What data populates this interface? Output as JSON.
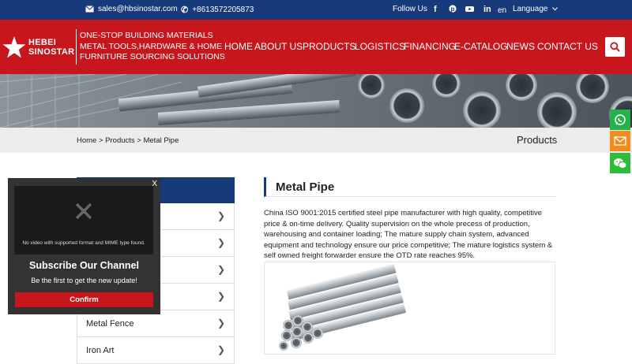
{
  "topbar": {
    "email": "sales@hbsinostar.com",
    "phone": "+8613572205873",
    "follow_label": "Follow Us",
    "lang_code": "en",
    "language_label": "Language"
  },
  "header": {
    "logo_line1": "HEBEI",
    "logo_line2": "SINOSTAR",
    "slogan": [
      "ONE-STOP BUILDING MATERIALS",
      "METAL TOOLS,HARDWARE & HOME",
      "FURNITURE SOURCING SOLUTIONS"
    ],
    "nav": [
      "HOME",
      "ABOUT US",
      "PRODUCTS",
      "LOGISTICS",
      "FINANCING",
      "E-CATALOG",
      "NEWS",
      "CONTACT US"
    ]
  },
  "breadcrumb": {
    "text": "Home > Products > Metal Pipe",
    "section": "Products"
  },
  "sidebar": {
    "items": [
      "",
      "",
      "",
      "",
      "Metal Fence",
      "Iron Art"
    ]
  },
  "content": {
    "title": "Metal Pipe",
    "description": "China ISO 9001:2015 certified steel pipe manufacturer with high quality, competitive price & on-time delivery. Quality supervision on the whole precess of production, warehousing and container loading; The mature supply chain system, advanced equipment and technology ensure our price competitive; The mature logistics system & self owned freight forwarder ensure the OTD rate reaches 95%."
  },
  "popup": {
    "close_label": "X",
    "video_message": "No video with supported format and MIME type found.",
    "title": "Subscribe Our Channel",
    "subtitle": "Be the first to get the new update!",
    "confirm_label": "Confirm"
  },
  "colors": {
    "brand_blue": "#173a7a",
    "brand_red": "#c8161d",
    "whatsapp_green": "#25b24a",
    "email_orange": "#f28c1e",
    "wechat_green": "#2dbd3a"
  },
  "icons": [
    "envelope-icon",
    "phone-icon",
    "facebook-icon",
    "pinterest-icon",
    "youtube-icon",
    "linkedin-icon",
    "chevron-down-icon",
    "search-icon",
    "whatsapp-icon",
    "email-icon",
    "wechat-icon",
    "video-error-icon"
  ]
}
